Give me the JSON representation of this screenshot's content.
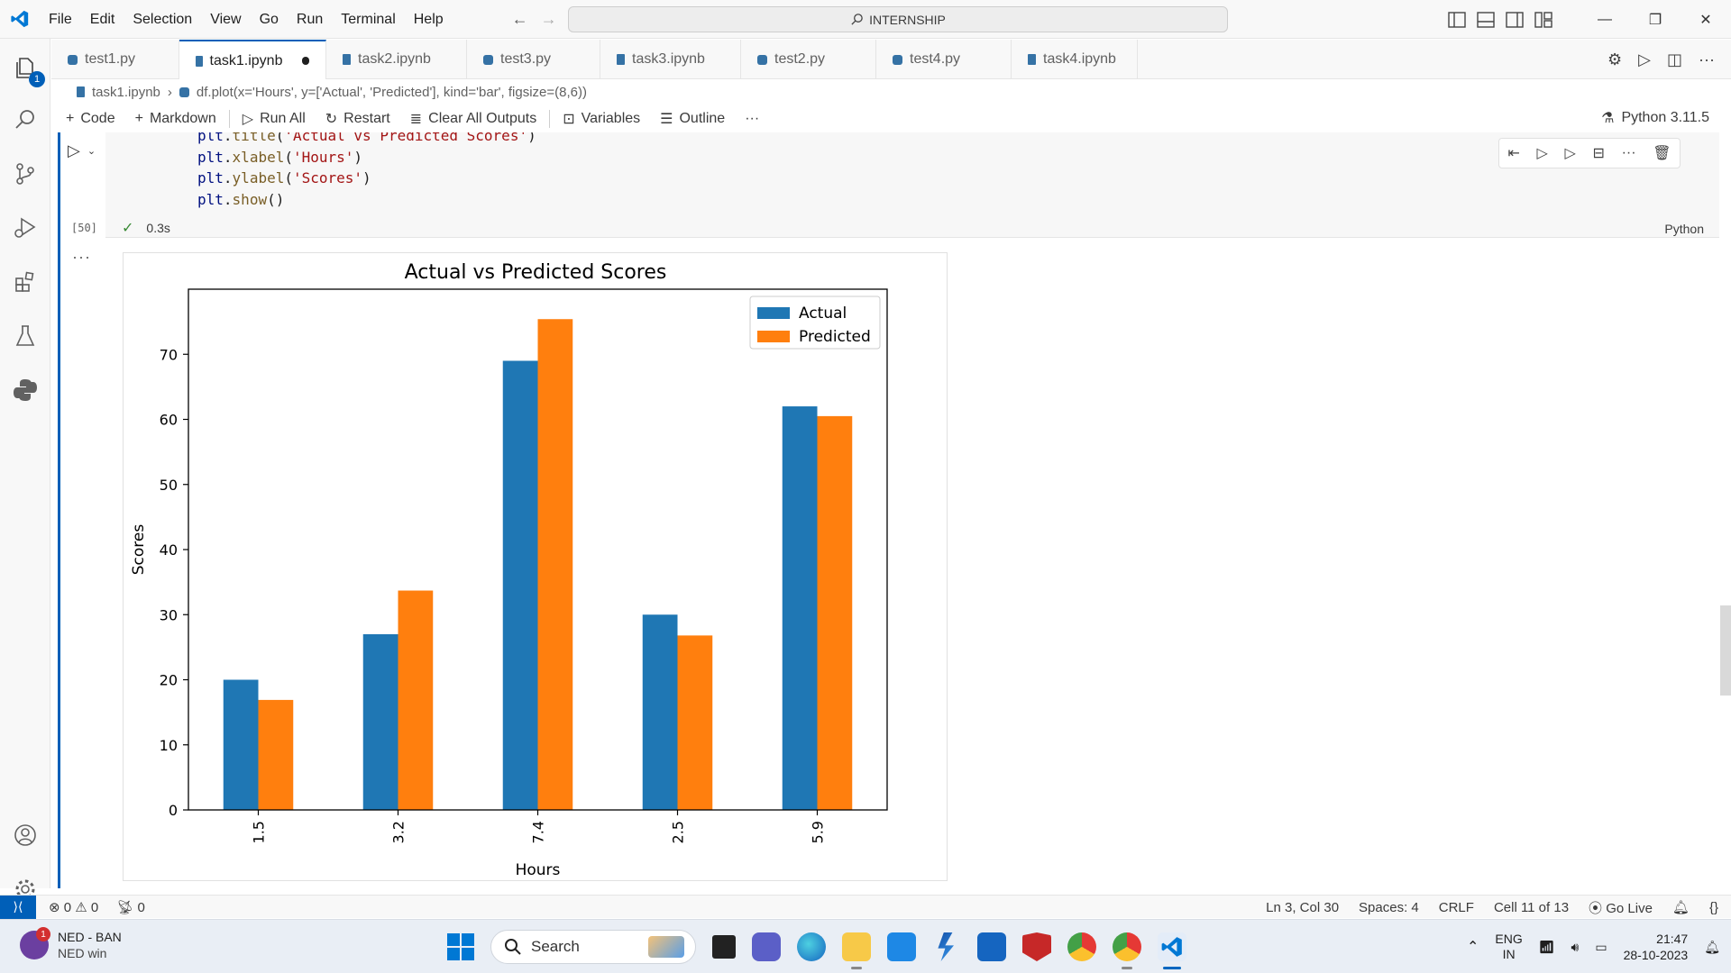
{
  "menu": [
    "File",
    "Edit",
    "Selection",
    "View",
    "Go",
    "Run",
    "Terminal",
    "Help"
  ],
  "command_center": "INTERNSHIP",
  "activity_badge": "1",
  "tabs": [
    {
      "label": "test1.py",
      "kind": "py"
    },
    {
      "label": "task1.ipynb",
      "kind": "nb",
      "active": true,
      "dirty": true
    },
    {
      "label": "task2.ipynb",
      "kind": "nb"
    },
    {
      "label": "test3.py",
      "kind": "py"
    },
    {
      "label": "task3.ipynb",
      "kind": "nb"
    },
    {
      "label": "test2.py",
      "kind": "py"
    },
    {
      "label": "test4.py",
      "kind": "py"
    },
    {
      "label": "task4.ipynb",
      "kind": "nb"
    }
  ],
  "breadcrumb": {
    "file": "task1.ipynb",
    "symbol": "df.plot(x='Hours', y=['Actual', 'Predicted'], kind='bar', figsize=(8,6))"
  },
  "toolbar": {
    "code": "Code",
    "markdown": "Markdown",
    "run_all": "Run All",
    "restart": "Restart",
    "clear_outputs": "Clear All Outputs",
    "variables": "Variables",
    "outline": "Outline",
    "more": "···",
    "kernel": "Python 3.11.5"
  },
  "cell": {
    "code_lines": [
      {
        "obj": "plt",
        "fn": "title",
        "arg": "'Actual vs Predicted Scores'"
      },
      {
        "obj": "plt",
        "fn": "xlabel",
        "arg": "'Hours'"
      },
      {
        "obj": "plt",
        "fn": "ylabel",
        "arg": "'Scores'"
      },
      {
        "obj": "plt",
        "fn": "show",
        "arg": ""
      }
    ],
    "execution_count": "[50]",
    "duration": "0.3s",
    "language": "Python",
    "output_dots": "···"
  },
  "chart_data": {
    "type": "bar",
    "title": "Actual vs Predicted Scores",
    "xlabel": "Hours",
    "ylabel": "Scores",
    "categories": [
      "1.5",
      "3.2",
      "7.4",
      "2.5",
      "5.9"
    ],
    "series": [
      {
        "name": "Actual",
        "values": [
          20,
          27,
          69,
          30,
          62
        ],
        "color": "#1f77b4"
      },
      {
        "name": "Predicted",
        "values": [
          16.9,
          33.7,
          75.4,
          26.8,
          60.5
        ],
        "color": "#ff7f0e"
      }
    ],
    "ylim": [
      0,
      80
    ],
    "yticks": [
      0,
      10,
      20,
      30,
      40,
      50,
      60,
      70
    ],
    "legend": "top-right",
    "grid": false
  },
  "statusbar": {
    "errors": "0",
    "warnings": "0",
    "ports": "0",
    "position": "Ln 3, Col 30",
    "spaces": "Spaces: 4",
    "eol": "CRLF",
    "cell": "Cell 11 of 13",
    "golive": "Go Live"
  },
  "taskbar": {
    "weather_badge": "1",
    "weather_title": "NED - BAN",
    "weather_sub": "NED win",
    "search": "Search",
    "lang_top": "ENG",
    "lang_bottom": "IN",
    "time": "21:47",
    "date": "28-10-2023"
  }
}
